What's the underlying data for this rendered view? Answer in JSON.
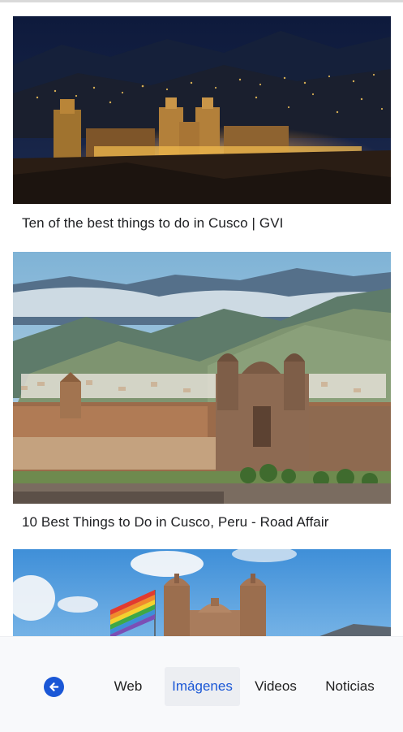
{
  "results": [
    {
      "caption": "Ten of the best things to do in Cusco | GVI",
      "image": "cusco-plaza-night-photo"
    },
    {
      "caption": "10 Best Things to Do in Cusco, Peru - Road Affair",
      "image": "cusco-cathedral-mountains-photo"
    },
    {
      "caption": "",
      "image": "cusco-cathedral-flag-photo"
    }
  ],
  "nav": {
    "back_icon": "arrow-left-icon",
    "tabs": [
      "Web",
      "Imágenes",
      "Videos",
      "Noticias"
    ],
    "active_tab": "Imágenes"
  },
  "colors": {
    "accent": "#1a57d6",
    "bar_bg": "#f8f9fb"
  }
}
